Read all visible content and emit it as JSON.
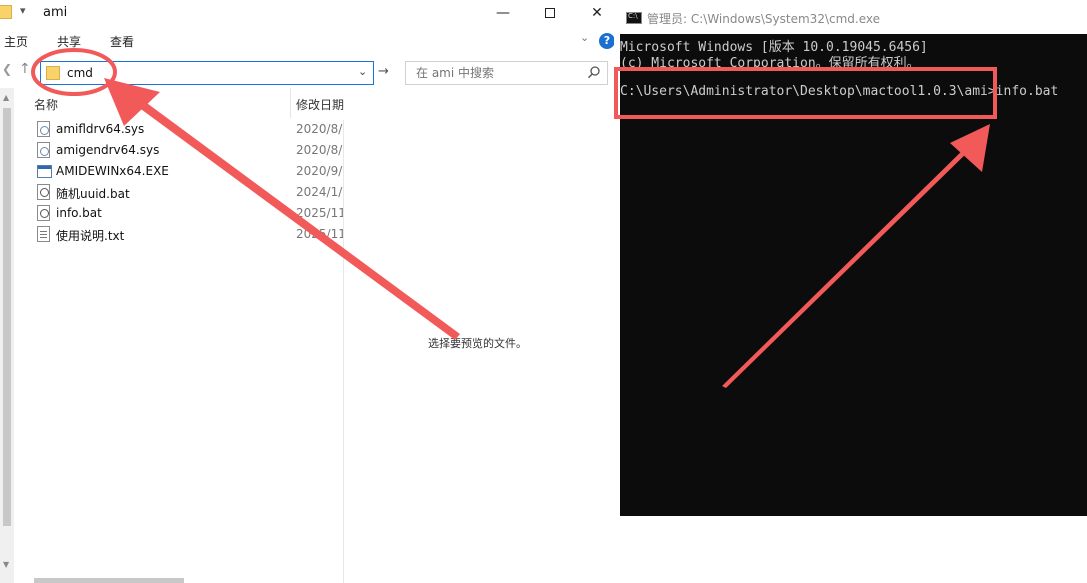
{
  "explorer": {
    "title": "ami",
    "quick_access_sep": "▾",
    "window_controls": {
      "minimize": "—",
      "close": "✕"
    },
    "ribbon_tabs": [
      "主页",
      "共享",
      "查看"
    ],
    "ribbon_collapse": "⌄",
    "help": "?",
    "address": {
      "value": "cmd",
      "dropdown": "⌄"
    },
    "go_arrow": "→",
    "search": {
      "placeholder": "在 ami 中搜索"
    },
    "columns": {
      "name": "名称",
      "date": "修改日期"
    },
    "files": [
      {
        "name": "amifldrv64.sys",
        "date": "2020/8/",
        "type": "sys"
      },
      {
        "name": "amigendrv64.sys",
        "date": "2020/8/",
        "type": "sys"
      },
      {
        "name": "AMIDEWINx64.EXE",
        "date": "2020/9/",
        "type": "exe"
      },
      {
        "name": "随机uuid.bat",
        "date": "2024/1/",
        "type": "bat"
      },
      {
        "name": "info.bat",
        "date": "2025/11",
        "type": "bat"
      },
      {
        "name": "使用说明.txt",
        "date": "2025/11",
        "type": "txt"
      }
    ],
    "preview_message": "选择要预览的文件。"
  },
  "cmd": {
    "title": "管理员: C:\\Windows\\System32\\cmd.exe",
    "lines": [
      "Microsoft Windows [版本 10.0.19045.6456]",
      "(c) Microsoft Corporation。保留所有权利。",
      "",
      "C:\\Users\\Administrator\\Desktop\\mactool1.0.3\\ami>info.bat"
    ]
  },
  "colors": {
    "annotation": "#f25a5a",
    "console_bg": "#0c0c0c",
    "console_text": "#cccccc",
    "accent": "#1a73d8"
  }
}
